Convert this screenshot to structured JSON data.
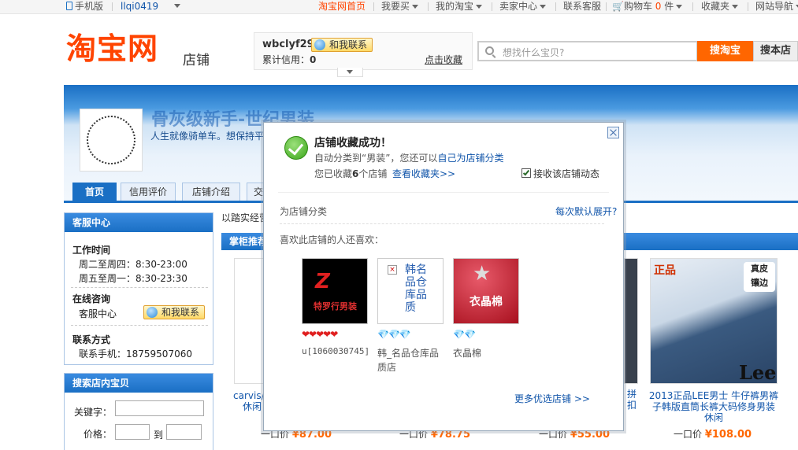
{
  "topbar": {
    "mobile": "手机版",
    "username": "llqi0419",
    "taobao_home": "淘宝网首页",
    "buy": "我要买",
    "my_taobao": "我的淘宝",
    "seller_center": "卖家中心",
    "customer_service": "联系客服",
    "cart_prefix": "购物车",
    "cart_count": "0",
    "cart_unit": "件",
    "favorites": "收藏夹",
    "site_nav": "网站导航"
  },
  "header": {
    "logo": "淘宝网",
    "logo_sub": "店铺",
    "seller_name": "wbclyf29",
    "contact_label": "和我联系",
    "credit_label": "累计信用：",
    "credit_value": "0",
    "favorite_link": "点击收藏",
    "search_placeholder": "想找什么宝贝?",
    "search_taobao": "搜淘宝",
    "search_shop": "搜本店"
  },
  "banner": {
    "shop_name": "骨灰级新手-世纪男装",
    "slogan": "人生就像骑单车。想保持平"
  },
  "nav": {
    "tabs": [
      "首页",
      "信用评价",
      "店铺介绍",
      "交"
    ]
  },
  "sidebar": {
    "service_title": "客服中心",
    "work_time_label": "工作时间",
    "work_time_1": "周二至周四：8:30-23:00",
    "work_time_2": "周五至周一：8:30-23:30",
    "online_label": "在线咨询",
    "online_text": "客服中心",
    "contact_btn": "和我联系",
    "contact_label": "联系方式",
    "phone": "联系手机：18759507060",
    "search_title": "搜索店内宝贝",
    "keyword_label": "关键字：",
    "price_label": "价格：",
    "to_label": "到"
  },
  "main": {
    "notice": "以踏实经营",
    "section_title": "掌柜推荐",
    "products": [
      {
        "title_1": "carvis/",
        "title_2": "休闲",
        "price_prefix": "一口价",
        "price": "¥87.00"
      },
      {
        "price_prefix": "一口价",
        "price": "¥78.75"
      },
      {
        "title_1": "拼",
        "title_2": "扣",
        "price_prefix": "一口价",
        "price": "¥55.00"
      },
      {
        "title_1": "2013正品LEE男士 牛仔裤男裤",
        "title_2": "子韩版直筒长裤大码修身男装",
        "title_3": "休闲",
        "price_prefix": "一口价",
        "price": "¥108.00",
        "badge_1": "正品",
        "badge_2": "真皮",
        "badge_3": "镶边",
        "brand": "Lee"
      }
    ]
  },
  "dialog": {
    "title": "店铺收藏成功！",
    "line1_a": "自动分类到“男装”，您还可以",
    "line1_link": "自己为店铺分类",
    "line2_a": "您已收藏",
    "line2_count": "6",
    "line2_b": "个店铺",
    "view_favorites": "查看收藏夹>>",
    "receive_updates": "接收该店铺动态",
    "categorize": "为店铺分类",
    "expand_default": "每次默认展开?",
    "also_like": "喜欢此店铺的人还喜欢：",
    "shops": [
      {
        "name": "u[1060030745]",
        "img_text": "特罗行男装"
      },
      {
        "name_1": "韩_名品仓库品",
        "name_2": "质店",
        "img_text": "韩名品仓库品质"
      },
      {
        "name": "衣晶棉",
        "img_text": "衣晶棉"
      }
    ],
    "more_shops": "更多优选店铺 >>"
  },
  "colors": {
    "accent": "#1a6fc4",
    "brand": "#ff4400",
    "price": "#ff6600"
  }
}
